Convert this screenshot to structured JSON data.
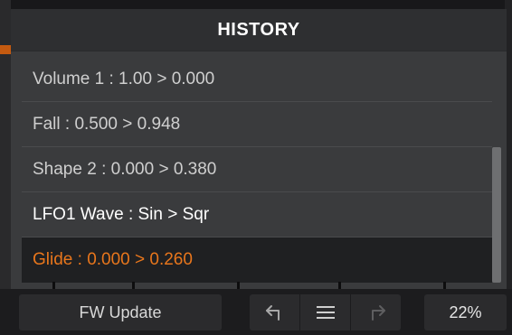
{
  "history": {
    "title": "HISTORY",
    "items": [
      {
        "label": "Volume 1 : 1.00 > 0.000"
      },
      {
        "label": "Fall : 0.500 > 0.948"
      },
      {
        "label": "Shape 2 : 0.000 > 0.380"
      },
      {
        "label": "LFO1 Wave : Sin > Sqr"
      },
      {
        "label": "Glide : 0.000 > 0.260"
      }
    ],
    "selected_color": "#e8761c"
  },
  "bottom_bar": {
    "fw_update_label": "FW Update",
    "undo_icon": "undo-icon",
    "menu_icon": "menu-icon",
    "redo_icon": "redo-icon",
    "zoom_label": "22%"
  }
}
